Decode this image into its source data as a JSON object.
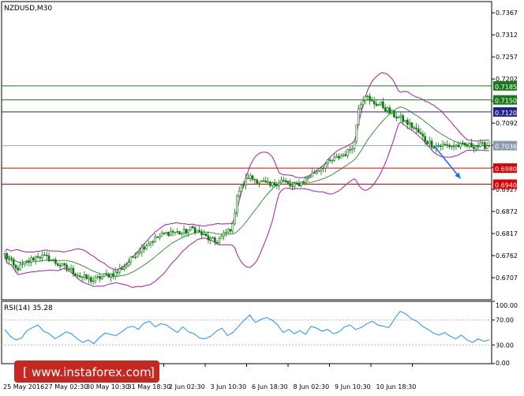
{
  "chart_data": [
    {
      "type": "candlestick",
      "title": "NZDUSD,M30",
      "symbol": "NZDUSD",
      "timeframe": "M30",
      "price_range": [
        0.6652,
        0.7395
      ],
      "y_ticks": [
        "0.7367",
        "0.7312",
        "0.7257",
        "0.7202",
        "0.7147",
        "0.7092",
        "0.7037",
        "0.6982",
        "0.6927",
        "0.6872",
        "0.6817",
        "0.6762",
        "0.6707"
      ],
      "x_ticks": [
        "25 May 2016",
        "27 May 02:30",
        "30 May 10:30",
        "31 May 18:30",
        "2 Jun 02:30",
        "3 Jun 10:30",
        "6 Jun 18:30",
        "8 Jun 02:30",
        "9 Jun 10:30",
        "10 Jun 18:30"
      ],
      "current_price": 0.7036,
      "current_price_label": "0.7036",
      "levels": [
        {
          "value": 0.7185,
          "label": "0.7185",
          "color": "#1a7a1a",
          "role": "resistance"
        },
        {
          "value": 0.715,
          "label": "0.7150",
          "color": "#1a7a1a",
          "role": "resistance"
        },
        {
          "value": 0.712,
          "label": "0.7120",
          "color": "#23238e",
          "role": "pivot"
        },
        {
          "value": 0.698,
          "label": "0.6980",
          "color": "#dd0000",
          "role": "support"
        },
        {
          "value": 0.694,
          "label": "0.6940",
          "color": "#dd0000",
          "role": "support"
        }
      ],
      "close_path": [
        [
          0,
          0.6765
        ],
        [
          5,
          0.6728
        ],
        [
          10,
          0.6745
        ],
        [
          15,
          0.6762
        ],
        [
          20,
          0.6755
        ],
        [
          25,
          0.6738
        ],
        [
          30,
          0.6725
        ],
        [
          35,
          0.6708
        ],
        [
          40,
          0.67
        ],
        [
          45,
          0.6712
        ],
        [
          50,
          0.6718
        ],
        [
          55,
          0.674
        ],
        [
          60,
          0.6772
        ],
        [
          65,
          0.6795
        ],
        [
          70,
          0.681
        ],
        [
          75,
          0.6822
        ],
        [
          80,
          0.6818
        ],
        [
          85,
          0.683
        ],
        [
          90,
          0.6812
        ],
        [
          95,
          0.6795
        ],
        [
          98,
          0.6808
        ],
        [
          103,
          0.6835
        ],
        [
          105,
          0.6915
        ],
        [
          110,
          0.6958
        ],
        [
          115,
          0.6948
        ],
        [
          120,
          0.6935
        ],
        [
          125,
          0.695
        ],
        [
          130,
          0.6932
        ],
        [
          135,
          0.6948
        ],
        [
          140,
          0.697
        ],
        [
          145,
          0.699
        ],
        [
          150,
          0.7005
        ],
        [
          155,
          0.702
        ],
        [
          158,
          0.7045
        ],
        [
          160,
          0.7135
        ],
        [
          163,
          0.7165
        ],
        [
          165,
          0.7145
        ],
        [
          170,
          0.7138
        ],
        [
          175,
          0.7115
        ],
        [
          180,
          0.71
        ],
        [
          185,
          0.708
        ],
        [
          190,
          0.705
        ],
        [
          194,
          0.7036
        ]
      ],
      "bollinger_band_indicator": true,
      "forecast_arrow": {
        "from": [
          194,
          0.7036
        ],
        "to": [
          206,
          0.6954
        ],
        "color": "#1e6bff"
      }
    },
    {
      "type": "line",
      "title": "RSI(14) 35.28",
      "indicator": "RSI",
      "period": 14,
      "last_value": 35.28,
      "ylim": [
        0,
        100
      ],
      "y_ticks": [
        "100.00",
        "70.00",
        "30.00",
        "0.00"
      ],
      "levels": [
        70,
        30
      ],
      "series": [
        {
          "values": [
            55,
            44,
            38,
            41,
            53,
            58,
            62,
            52,
            48,
            40,
            45,
            51,
            48,
            40,
            34,
            38,
            32,
            42,
            49,
            47,
            45,
            51,
            58,
            60,
            55,
            65,
            68,
            59,
            64,
            62,
            56,
            50,
            59,
            51,
            48,
            41,
            40,
            44,
            52,
            57,
            45,
            50,
            60,
            70,
            78,
            66,
            71,
            74,
            70,
            62,
            50,
            55,
            48,
            53,
            47,
            60,
            57,
            52,
            55,
            48,
            51,
            59,
            62,
            55,
            58,
            64,
            68,
            62,
            60,
            58,
            72,
            84,
            80,
            72,
            68,
            60,
            55,
            49,
            46,
            50,
            44,
            40,
            46,
            38,
            34,
            40,
            36,
            38
          ]
        }
      ]
    }
  ],
  "watermark": "www.instaforex.com",
  "colors": {
    "candle": "#0a7a0a",
    "bollinger": "#a020a0",
    "rsi_line": "#1e90ff",
    "watermark_bg": "#c42820",
    "axis": "#000000",
    "dotted": "#bbbbbb",
    "current_label_bg": "#8a9aab"
  }
}
